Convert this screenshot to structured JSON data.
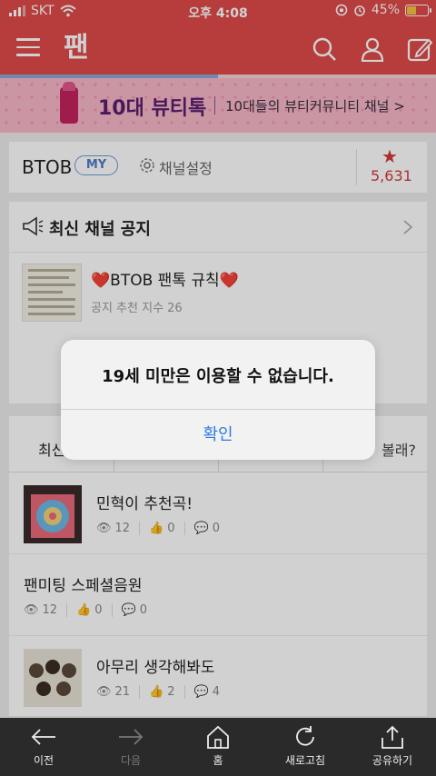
{
  "status_bar": {
    "carrier": "SKT",
    "time": "오후 4:08",
    "battery": "45%",
    "battery_level": 0.45
  },
  "app_bar": {
    "logo_text": "팬",
    "icons": [
      "menu-icon",
      "search-icon",
      "profile-icon",
      "edit-icon"
    ]
  },
  "page_progress": 0.5,
  "banner": {
    "title": "10대 뷰티톡",
    "subtitle": "10대들의 뷰티커뮤니티 채널 >"
  },
  "channel": {
    "name": "BTOB",
    "badge": "MY",
    "settings_label": "채널설정",
    "star": "★",
    "star_count": "5,631"
  },
  "notice": {
    "heading": "최신 채널 공지",
    "post_title": "❤️BTOB 팬톡 규칙❤️",
    "post_meta": "공지 추천 지수 26"
  },
  "list": {
    "tab_first": "최신",
    "tab_last": "볼래?",
    "posts": [
      {
        "title": "민혁이 추천곡!",
        "views": "12",
        "likes": "0",
        "comments": "0"
      },
      {
        "title": "팬미팅 스페셜음원",
        "views": "12",
        "likes": "0",
        "comments": "0"
      },
      {
        "title": "아무리 생각해봐도",
        "views": "21",
        "likes": "2",
        "comments": "4"
      }
    ]
  },
  "bottom_bar": {
    "back": "이전",
    "forward": "다음",
    "home": "홈",
    "refresh": "새로고침",
    "share": "공유하기"
  },
  "alert": {
    "message": "19세 미만은 이용할 수 없습니다.",
    "confirm": "확인"
  },
  "colors": {
    "brand_red": "#e04a4a",
    "accent_blue": "#2f7ae5",
    "star_red": "#d23a3a"
  }
}
